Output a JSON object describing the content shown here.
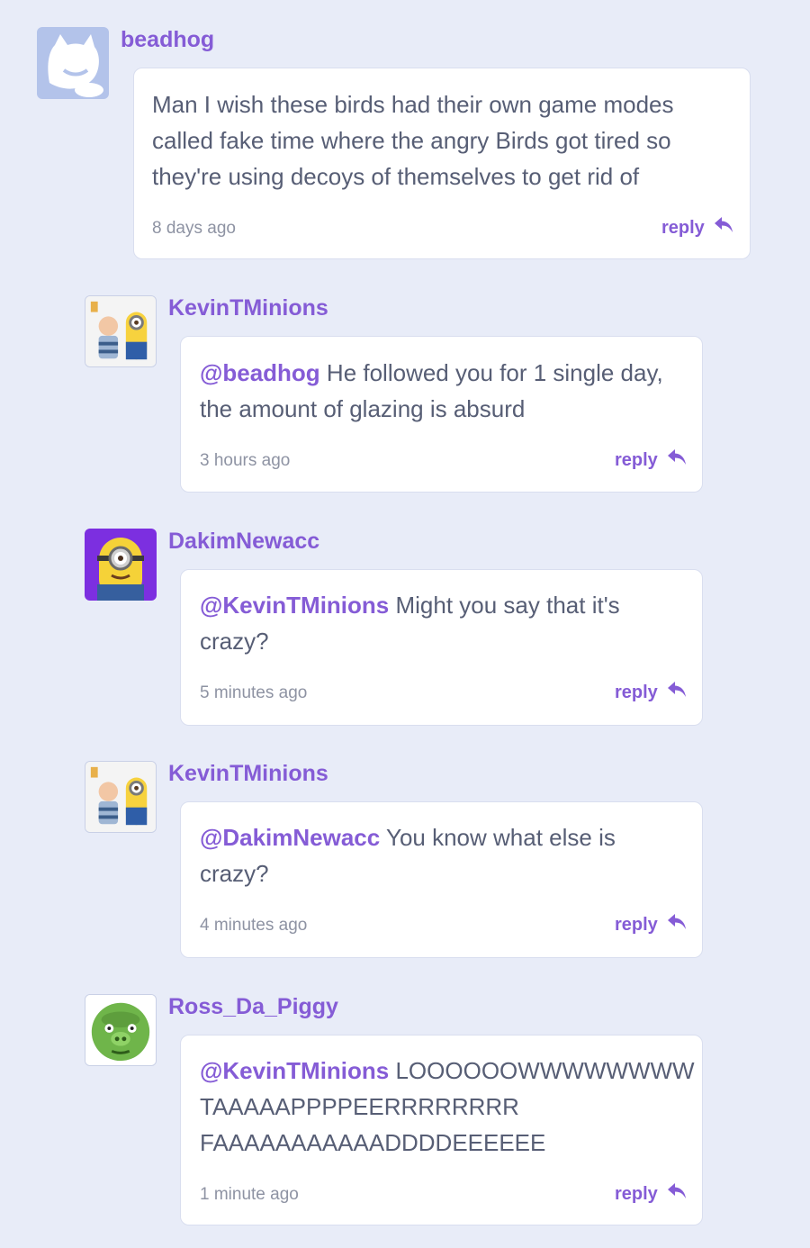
{
  "comments": [
    {
      "user": "beadhog",
      "avatar": "scratch-cat-avatar",
      "lines": [
        "Man I wish these birds had their own game modes",
        "called fake time where the angry Birds got tired so",
        "they're using decoys of themselves to get rid of"
      ],
      "time": "8 days ago",
      "reply": "reply"
    },
    {
      "user": "KevinTMinions",
      "avatar": "kid-and-minion-avatar",
      "mention": "@beadhog",
      "first_rest": " He followed you for 1 single day,",
      "lines_rest": [
        "the amount of glazing is absurd"
      ],
      "time": "3 hours ago",
      "reply": "reply"
    },
    {
      "user": "DakimNewacc",
      "avatar": "minion-avatar",
      "mention": "@KevinTMinions",
      "first_rest": " Might you say that it's",
      "lines_rest": [
        "crazy?"
      ],
      "time": "5 minutes ago",
      "reply": "reply"
    },
    {
      "user": "KevinTMinions",
      "avatar": "kid-and-minion-avatar",
      "mention": "@DakimNewacc",
      "first_rest": " You know what else is",
      "lines_rest": [
        "crazy?"
      ],
      "time": "4 minutes ago",
      "reply": "reply"
    },
    {
      "user": "Ross_Da_Piggy",
      "avatar": "green-pig-avatar",
      "mention": "@KevinTMinions",
      "first_rest": " LOOOOOOWWWWWWWW",
      "lines_rest": [
        "TAAAAAPPPPEERRRRRRRR",
        "FAAAAAAAAAAADDDDEEEEEE"
      ],
      "time": "1 minute ago",
      "reply": "reply"
    }
  ],
  "colors": {
    "accent": "#855cd6",
    "background": "#e8ecf8",
    "text": "#575e75",
    "muted": "#8e93a3"
  }
}
